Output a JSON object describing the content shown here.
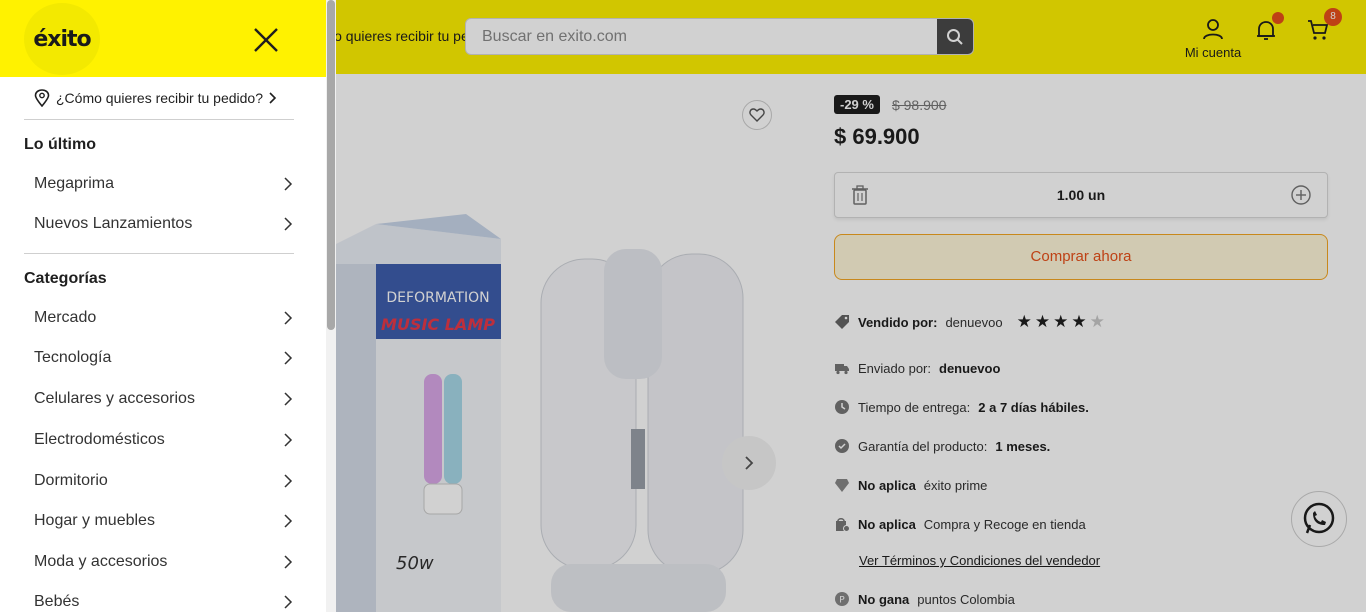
{
  "header": {
    "delivery_text": "¿Cómo quieres recibir tu pedido?",
    "search_placeholder": "Buscar en exito.com",
    "account_label": "Mi cuenta",
    "cart_count": "8",
    "brand_color": "#fff200",
    "accent_color": "#e8501a"
  },
  "product": {
    "discount": "-29 %",
    "old_price": "$ 98.900",
    "price": "$ 69.900",
    "quantity": "1.00 un",
    "buy_label": "Comprar ahora",
    "sold_by_label": "Vendido por:",
    "sold_by_value": "denuevoo",
    "rating": 4,
    "rating_max": 5,
    "features": {
      "shipped_label": "Enviado por:",
      "shipped_value": "denuevoo",
      "delivery_label": "Tiempo de entrega:",
      "delivery_value": "2 a 7 días hábiles.",
      "warranty_label": "Garantía del producto:",
      "warranty_value": "1 meses.",
      "prime_label": "No aplica",
      "prime_value": "éxito prime",
      "pickup_label": "No aplica",
      "pickup_value": "Compra y Recoge en tienda",
      "terms_link": "Ver Términos y Condiciones del vendedor",
      "points_label": "No gana",
      "points_value": "puntos Colombia"
    },
    "image_text_1": "DEFORMATION",
    "image_text_2": "MUSIC LAMP",
    "image_text_3": "50w"
  },
  "drawer": {
    "logo_text": "éxito",
    "delivery_text": "¿Cómo quieres recibir tu pedido?",
    "section_latest": "Lo último",
    "latest_items": [
      "Megaprima",
      "Nuevos Lanzamientos"
    ],
    "section_categories": "Categorías",
    "category_items": [
      "Mercado",
      "Tecnología",
      "Celulares y accesorios",
      "Electrodomésticos",
      "Dormitorio",
      "Hogar y muebles",
      "Moda y accesorios",
      "Bebés"
    ]
  }
}
